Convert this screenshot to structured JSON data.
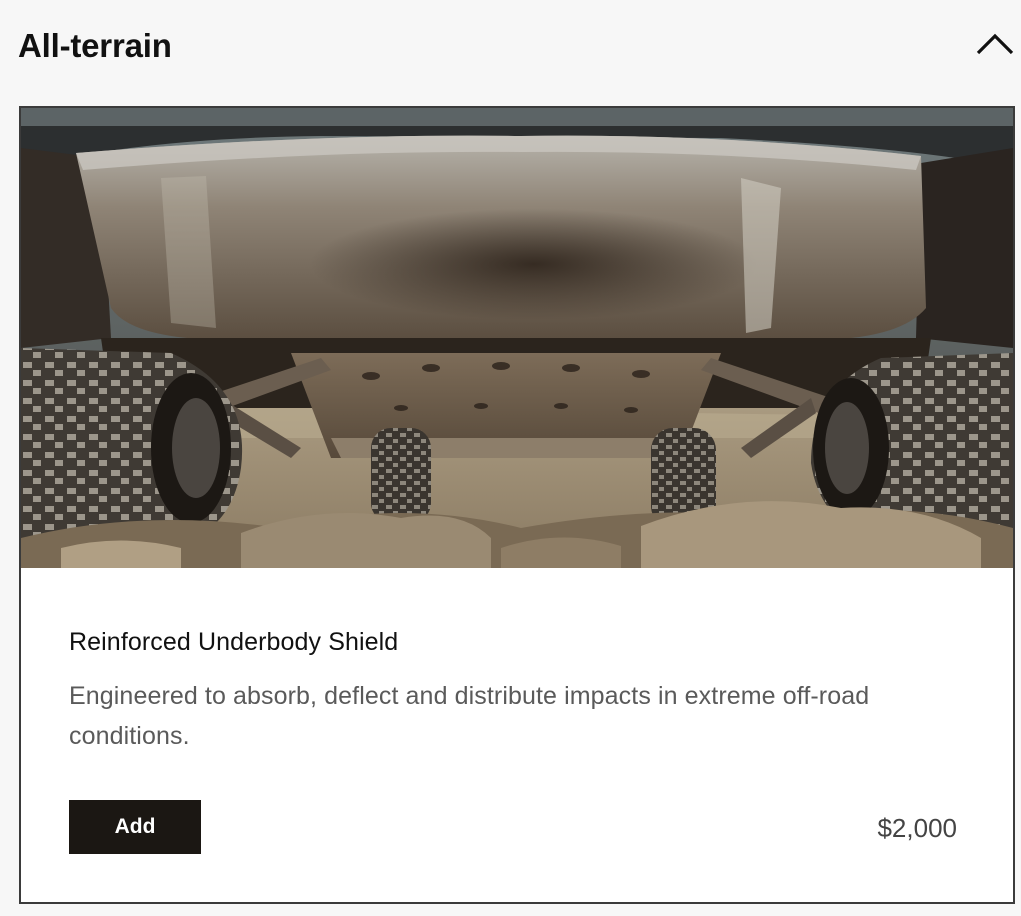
{
  "section": {
    "title": "All-terrain",
    "toggle_icon": "chevron-up-icon",
    "expanded": true
  },
  "product": {
    "image_alt": "Vehicle underbody skid plate over rocky terrain",
    "title": "Reinforced Underbody Shield",
    "description": "Engineered to absorb, deflect and distribute impacts in extreme off-road conditions.",
    "add_label": "Add",
    "price": "$2,000"
  },
  "colors": {
    "page_background": "#f7f7f7",
    "card_border": "#3b3b3b",
    "button_background": "#1b1713",
    "button_text": "#ffffff",
    "title_text": "#111111",
    "body_text": "#5a5a5a"
  }
}
